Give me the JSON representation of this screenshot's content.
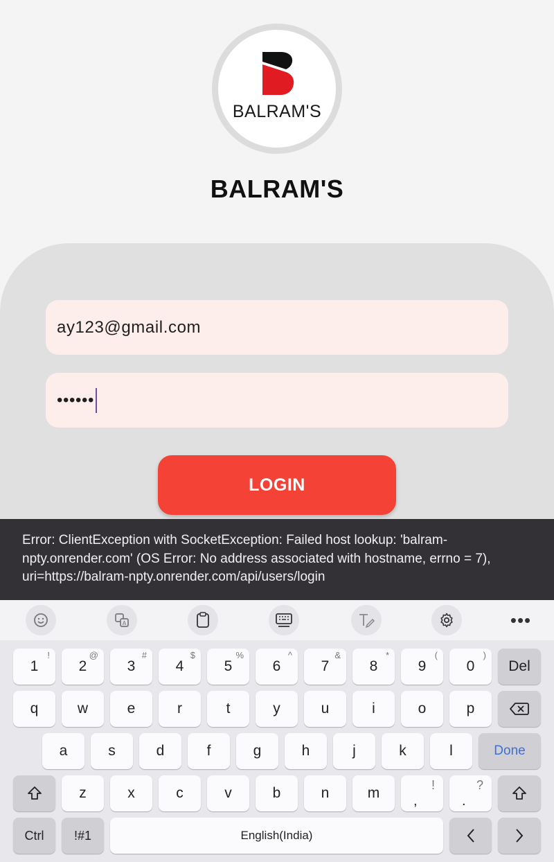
{
  "logo": {
    "text": "BALRAM'S"
  },
  "app": {
    "title": "BALRAM'S"
  },
  "form": {
    "email_value": "ay123@gmail.com",
    "password_value": "••••••",
    "login_label": "LOGIN"
  },
  "snackbar": {
    "message": "Error: ClientException with SocketException: Failed host lookup: 'balram-npty.onrender.com' (OS Error: No address associated with hostname, errno = 7), uri=https://balram-npty.onrender.com/api/users/login"
  },
  "keyboard": {
    "toolbar": [
      "emoji-icon",
      "translate-icon",
      "clipboard-icon",
      "keyboard-icon",
      "handwriting-icon",
      "gear-icon"
    ],
    "more_label": "•••",
    "row1": [
      {
        "k": "1",
        "h": "!"
      },
      {
        "k": "2",
        "h": "@"
      },
      {
        "k": "3",
        "h": "#"
      },
      {
        "k": "4",
        "h": "$"
      },
      {
        "k": "5",
        "h": "%"
      },
      {
        "k": "6",
        "h": "^"
      },
      {
        "k": "7",
        "h": "&"
      },
      {
        "k": "8",
        "h": "*"
      },
      {
        "k": "9",
        "h": "("
      },
      {
        "k": "0",
        "h": ")"
      }
    ],
    "del_label": "Del",
    "row2": [
      "q",
      "w",
      "e",
      "r",
      "t",
      "y",
      "u",
      "i",
      "o",
      "p"
    ],
    "row3": [
      "a",
      "s",
      "d",
      "f",
      "g",
      "h",
      "j",
      "k",
      "l"
    ],
    "done_label": "Done",
    "row4": [
      "z",
      "x",
      "c",
      "v",
      "b",
      "n",
      "m"
    ],
    "comma_key": {
      "k": ",",
      "h": "!"
    },
    "period_key": {
      "k": ".",
      "h": "?"
    },
    "ctrl_label": "Ctrl",
    "symbols_label": "!#1",
    "space_label": "English(India)"
  },
  "colors": {
    "accent": "#f44336",
    "field_bg": "#fdeeec",
    "snackbar_bg": "#333136",
    "done_text": "#3d6fd6"
  }
}
